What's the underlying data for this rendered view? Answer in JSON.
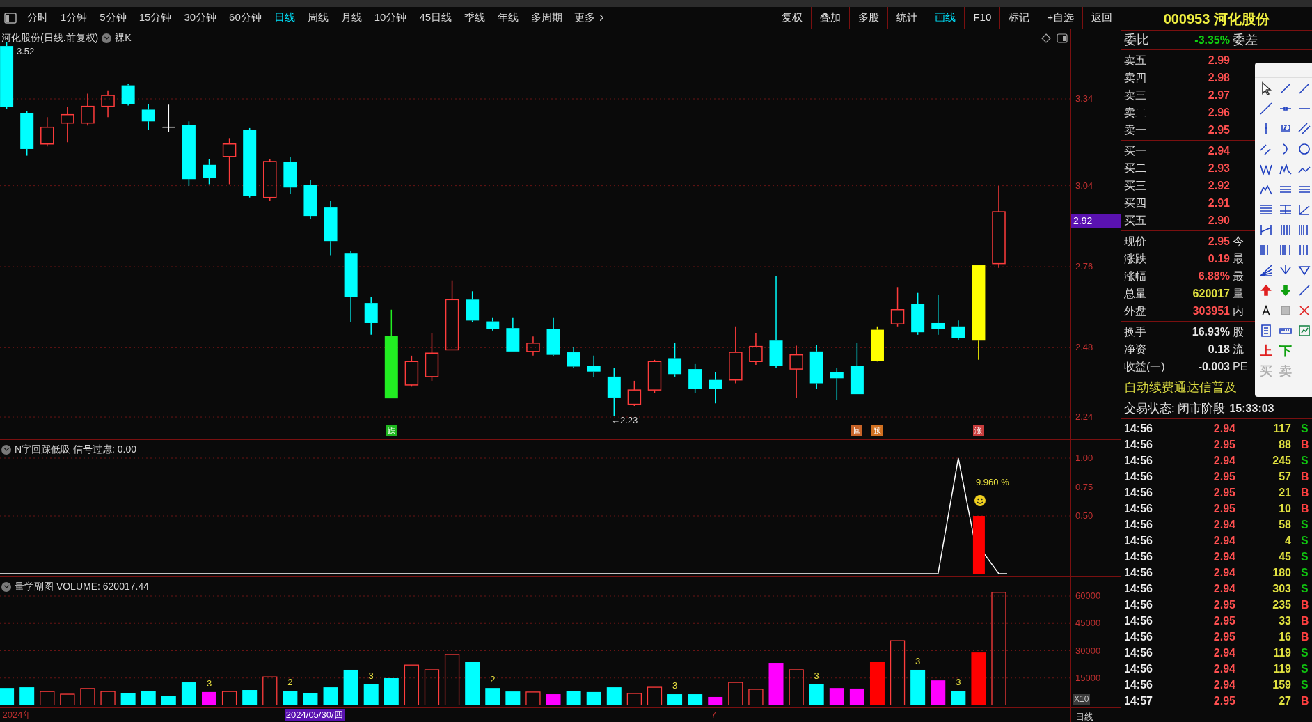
{
  "toolbar": {
    "periods": [
      {
        "label": "分时",
        "selected": false
      },
      {
        "label": "1分钟",
        "selected": false
      },
      {
        "label": "5分钟",
        "selected": false
      },
      {
        "label": "15分钟",
        "selected": false
      },
      {
        "label": "30分钟",
        "selected": false
      },
      {
        "label": "60分钟",
        "selected": false
      },
      {
        "label": "日线",
        "selected": true
      },
      {
        "label": "周线",
        "selected": false
      },
      {
        "label": "月线",
        "selected": false
      },
      {
        "label": "10分钟",
        "selected": false
      },
      {
        "label": "45日线",
        "selected": false
      },
      {
        "label": "季线",
        "selected": false
      },
      {
        "label": "年线",
        "selected": false
      },
      {
        "label": "多周期",
        "selected": false
      }
    ],
    "more": "更多",
    "tools": [
      {
        "label": "复权",
        "selected": false
      },
      {
        "label": "叠加",
        "selected": false
      },
      {
        "label": "多股",
        "selected": false
      },
      {
        "label": "统计",
        "selected": false
      },
      {
        "label": "画线",
        "selected": true
      },
      {
        "label": "F10",
        "selected": false
      },
      {
        "label": "标记",
        "selected": false
      },
      {
        "label": "+自选",
        "selected": false
      },
      {
        "label": "返回",
        "selected": false
      }
    ]
  },
  "main_chart": {
    "title": "河化股份(日线.前复权)",
    "mode": "裸K",
    "yticks": [
      "3.34",
      "3.04",
      "2.76",
      "2.48",
      "2.24"
    ],
    "last_price": "2.92",
    "high_label": "3.52",
    "low_label": "←2.23",
    "signals": [
      {
        "text": "跌",
        "color": "#1fb81f"
      },
      {
        "text": "回",
        "color": "#c86428"
      },
      {
        "text": "预",
        "color": "#d07020"
      },
      {
        "text": "涨",
        "color": "#c83c3c"
      }
    ]
  },
  "indicator": {
    "title": "N字回踩低吸 信号过虑: 0.00",
    "signal_label": "9.960 %",
    "yticks": [
      "1.00",
      "0.75",
      "0.50"
    ]
  },
  "volume": {
    "title": "量学副图 VOLUME: 620017.44",
    "scale_label": "X10",
    "yticks": [
      "60000",
      "45000",
      "30000",
      "15000"
    ],
    "bar_labels": [
      "3",
      "2",
      "3",
      "2",
      "3",
      "3",
      "3",
      "3"
    ]
  },
  "date_axis": [
    {
      "text": "2024年",
      "kind": "plain"
    },
    {
      "text": "2024/05/30/四",
      "kind": "cursor"
    },
    {
      "text": "7",
      "kind": "plain"
    }
  ],
  "period_label": "日线",
  "stock": {
    "code": "000953",
    "name": "河化股份"
  },
  "order_ratio": {
    "label": "委比",
    "value": "-3.35%",
    "right_label": "委差"
  },
  "asks": [
    {
      "label": "卖五",
      "value": "2.99"
    },
    {
      "label": "卖四",
      "value": "2.98"
    },
    {
      "label": "卖三",
      "value": "2.97"
    },
    {
      "label": "卖二",
      "value": "2.96"
    },
    {
      "label": "卖一",
      "value": "2.95"
    }
  ],
  "bids": [
    {
      "label": "买一",
      "value": "2.94"
    },
    {
      "label": "买二",
      "value": "2.93"
    },
    {
      "label": "买三",
      "value": "2.92"
    },
    {
      "label": "买四",
      "value": "2.91"
    },
    {
      "label": "买五",
      "value": "2.90"
    }
  ],
  "quotes": [
    {
      "label": "现价",
      "value": "2.95",
      "color": "#ff5050",
      "right_label": "今"
    },
    {
      "label": "涨跌",
      "value": "0.19",
      "color": "#ff5050",
      "right_label": "最"
    },
    {
      "label": "涨幅",
      "value": "6.88%",
      "color": "#ff5050",
      "right_label": "最"
    },
    {
      "label": "总量",
      "value": "620017",
      "color": "#e0e040",
      "right_label": "量"
    },
    {
      "label": "外盘",
      "value": "303951",
      "color": "#ff5050",
      "right_label": "内"
    }
  ],
  "fundamentals": [
    {
      "label": "换手",
      "value": "16.93%",
      "right_label": "股"
    },
    {
      "label": "净资",
      "value": "0.18",
      "right_label": "流"
    },
    {
      "label": "收益(一)",
      "value": "-0.003",
      "right_label": "PE"
    }
  ],
  "banner": "自动续费通达信普及",
  "trade_status": {
    "label": "交易状态: 闭市阶段",
    "time": "15:33:03"
  },
  "ticks": [
    {
      "time": "14:56",
      "price": "2.94",
      "volume": "117",
      "side": "S",
      "color": "#10c010"
    },
    {
      "time": "14:56",
      "price": "2.95",
      "volume": "88",
      "side": "B",
      "color": "#ff4040"
    },
    {
      "time": "14:56",
      "price": "2.94",
      "volume": "245",
      "side": "S",
      "color": "#10c010"
    },
    {
      "time": "14:56",
      "price": "2.95",
      "volume": "57",
      "side": "B",
      "color": "#ff4040"
    },
    {
      "time": "14:56",
      "price": "2.95",
      "volume": "21",
      "side": "B",
      "color": "#ff4040"
    },
    {
      "time": "14:56",
      "price": "2.95",
      "volume": "10",
      "side": "B",
      "color": "#ff4040"
    },
    {
      "time": "14:56",
      "price": "2.94",
      "volume": "58",
      "side": "S",
      "color": "#10c010"
    },
    {
      "time": "14:56",
      "price": "2.94",
      "volume": "4",
      "side": "S",
      "color": "#10c010"
    },
    {
      "time": "14:56",
      "price": "2.94",
      "volume": "45",
      "side": "S",
      "color": "#10c010"
    },
    {
      "time": "14:56",
      "price": "2.94",
      "volume": "180",
      "side": "S",
      "color": "#10c010"
    },
    {
      "time": "14:56",
      "price": "2.94",
      "volume": "303",
      "side": "S",
      "color": "#10c010"
    },
    {
      "time": "14:56",
      "price": "2.95",
      "volume": "235",
      "side": "B",
      "color": "#ff4040"
    },
    {
      "time": "14:56",
      "price": "2.95",
      "volume": "33",
      "side": "B",
      "color": "#ff4040"
    },
    {
      "time": "14:56",
      "price": "2.95",
      "volume": "16",
      "side": "B",
      "color": "#ff4040"
    },
    {
      "time": "14:56",
      "price": "2.94",
      "volume": "119",
      "side": "S",
      "color": "#10c010"
    },
    {
      "time": "14:56",
      "price": "2.94",
      "volume": "119",
      "side": "S",
      "color": "#10c010"
    },
    {
      "time": "14:56",
      "price": "2.94",
      "volume": "159",
      "side": "S",
      "color": "#10c010"
    },
    {
      "time": "14:57",
      "price": "2.95",
      "volume": "27",
      "side": "B",
      "color": "#ff4040"
    }
  ],
  "drawing_palette": {
    "labels": [
      {
        "text": "上",
        "color": "#e02020"
      },
      {
        "text": "下",
        "color": "#10a010"
      },
      {
        "text": "买",
        "color": "#b0b0b0"
      },
      {
        "text": "卖",
        "color": "#b0b0b0"
      }
    ]
  }
}
